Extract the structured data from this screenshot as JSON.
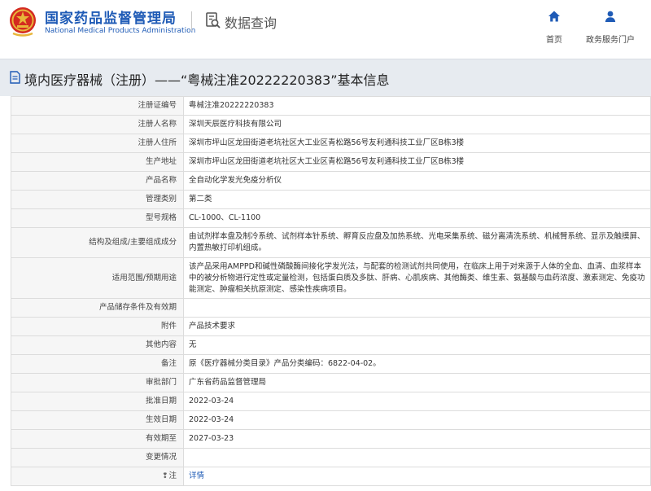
{
  "header": {
    "org_name_cn": "国家药品监督管理局",
    "org_name_en": "National Medical Products Administration",
    "query_title": "数据查询",
    "nav": {
      "home_label": "首页",
      "portal_label": "政务服务门户"
    }
  },
  "page": {
    "title": "境内医疗器械（注册）——“粤械注准20222220383”基本信息"
  },
  "fields": [
    {
      "label": "注册证编号",
      "value": "粤械注准20222220383"
    },
    {
      "label": "注册人名称",
      "value": "深圳天辰医疗科技有限公司"
    },
    {
      "label": "注册人住所",
      "value": "深圳市坪山区龙田街道老坑社区大工业区青松路56号友利通科技工业厂区B栋3楼"
    },
    {
      "label": "生产地址",
      "value": "深圳市坪山区龙田街道老坑社区大工业区青松路56号友利通科技工业厂区B栋3楼"
    },
    {
      "label": "产品名称",
      "value": "全自动化学发光免疫分析仪"
    },
    {
      "label": "管理类别",
      "value": "第二类"
    },
    {
      "label": "型号规格",
      "value": "CL-1000、CL-1100"
    },
    {
      "label": "结构及组成/主要组成成分",
      "value": "由试剂样本盘及制冷系统、试剂样本针系统、孵育反应盘及加热系统、光电采集系统、磁分离清洗系统、机械臂系统、显示及触摸屏、内置热敏打印机组成。"
    },
    {
      "label": "适用范围/预期用途",
      "value": "该产品采用AMPPD和碱性磷酸酶间接化学发光法，与配套的检测试剂共同使用，在临床上用于对来源于人体的全血、血清、血浆样本中的被分析物进行定性或定量检测，包括蛋白质及多肽、肝病、心肌疾病、其他酶类、维生素、氨基酸与血药浓度、激素测定、免疫功能测定、肿瘤相关抗原测定、感染性疾病项目。"
    },
    {
      "label": "产品储存条件及有效期",
      "value": ""
    },
    {
      "label": "附件",
      "value": "产品技术要求"
    },
    {
      "label": "其他内容",
      "value": "无"
    },
    {
      "label": "备注",
      "value": "原《医疗器械分类目录》产品分类编码：6822-04-02。"
    },
    {
      "label": "审批部门",
      "value": "广东省药品监督管理局"
    },
    {
      "label": "批准日期",
      "value": "2022-03-24"
    },
    {
      "label": "生效日期",
      "value": "2022-03-24"
    },
    {
      "label": "有效期至",
      "value": "2027-03-23"
    },
    {
      "label": "变更情况",
      "value": ""
    }
  ],
  "note_row": {
    "label_icon": "note-icon",
    "label_glyph": "❢",
    "label": "注",
    "link": "详情"
  },
  "colors": {
    "brand_blue": "#1f5bb6",
    "emblem_red": "#d42a20",
    "emblem_gold": "#e8b63a",
    "title_band": "#e7ebf0"
  }
}
